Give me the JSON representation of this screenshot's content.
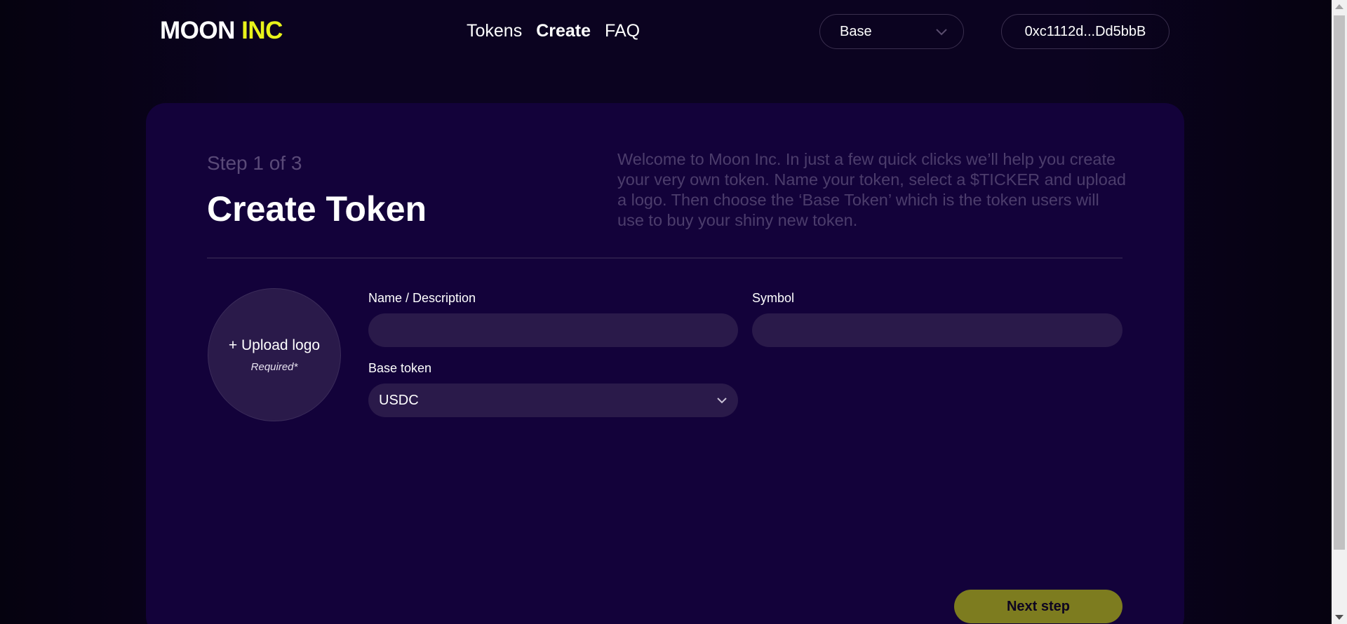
{
  "header": {
    "logo_main": "MOON",
    "logo_accent": "INC",
    "nav": [
      "Tokens",
      "Create",
      "FAQ"
    ],
    "active_nav": "Create",
    "network": "Base",
    "wallet": "0xc1112d...Dd5bbB"
  },
  "card": {
    "step": "Step 1 of 3",
    "title": "Create Token",
    "intro": "Welcome to Moon Inc. In just a few quick clicks we’ll help you create your very own token. Name your token, select a $TICKER and upload a logo. Then choose the ‘Base Token’ which is the token users will use to buy your shiny new token.",
    "upload_label": "+ Upload logo",
    "upload_required": "Required*",
    "name_label": "Name / Description",
    "name_value": "",
    "symbol_label": "Symbol",
    "symbol_value": "",
    "base_token_label": "Base token",
    "base_token_value": "USDC",
    "next_button": "Next step"
  },
  "colors": {
    "accent": "#e8f31a",
    "card_bg": "#13023a",
    "field_bg": "#2a1a4a",
    "button_bg": "#7d7c1f"
  },
  "icons": {
    "network_chevron": "chevron-down-icon",
    "base_token_chevron": "chevron-down-icon"
  }
}
